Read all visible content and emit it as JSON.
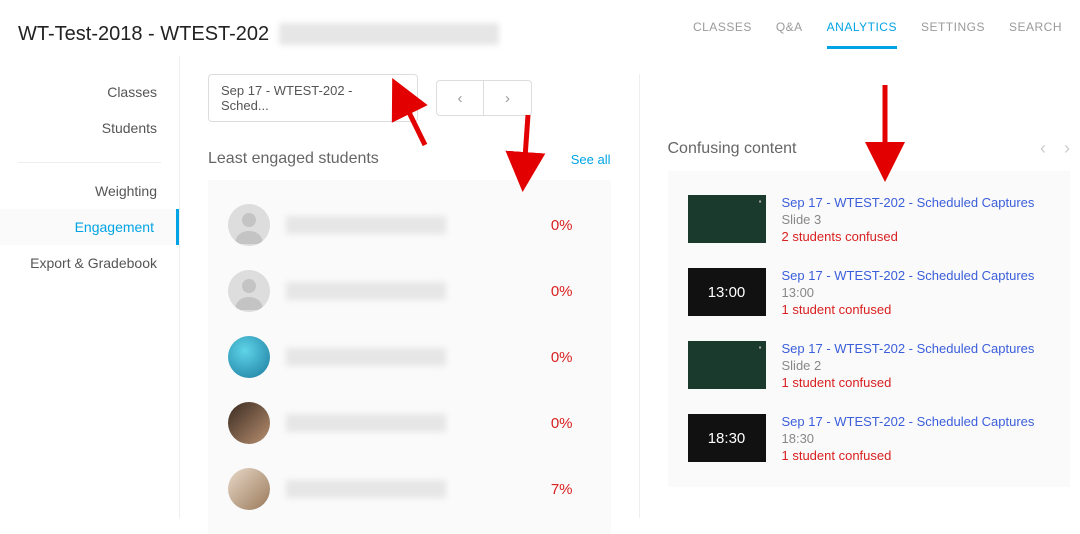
{
  "header": {
    "title": "WT-Test-2018 - WTEST-202"
  },
  "tabs": {
    "classes": "CLASSES",
    "qa": "Q&A",
    "analytics": "ANALYTICS",
    "settings": "SETTINGS",
    "search": "SEARCH"
  },
  "sidebar": {
    "classes": "Classes",
    "students": "Students",
    "weighting": "Weighting",
    "engagement": "Engagement",
    "export": "Export & Gradebook"
  },
  "dropdown": {
    "label": "Sep 17 - WTEST-202 - Sched..."
  },
  "least": {
    "title": "Least engaged students",
    "see_all": "See all",
    "rows": [
      {
        "pct": "0%"
      },
      {
        "pct": "0%"
      },
      {
        "pct": "0%"
      },
      {
        "pct": "0%"
      },
      {
        "pct": "7%"
      }
    ]
  },
  "confusing": {
    "title": "Confusing content",
    "rows": [
      {
        "title": "Sep 17 - WTEST-202 - Scheduled Captures",
        "sub": "Slide 3",
        "count": "2 students confused",
        "thumb_type": "slide"
      },
      {
        "title": "Sep 17 - WTEST-202 - Scheduled Captures",
        "sub": "13:00",
        "count": "1 student confused",
        "thumb_type": "video",
        "time": "13:00"
      },
      {
        "title": "Sep 17 - WTEST-202 - Scheduled Captures",
        "sub": "Slide 2",
        "count": "1 student confused",
        "thumb_type": "slide"
      },
      {
        "title": "Sep 17 - WTEST-202 - Scheduled Captures",
        "sub": "18:30",
        "count": "1 student confused",
        "thumb_type": "video",
        "time": "18:30"
      }
    ]
  }
}
